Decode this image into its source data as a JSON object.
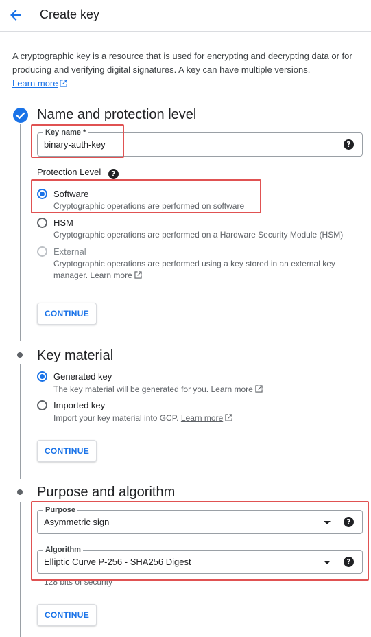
{
  "header": {
    "title": "Create key"
  },
  "intro": {
    "text": "A cryptographic key is a resource that is used for encrypting and decrypting data or for producing and verifying digital signatures. A key can have multiple versions.",
    "link": "Learn more"
  },
  "section1": {
    "title": "Name and protection level",
    "key_name_label": "Key name *",
    "key_name_value": "binary-auth-key",
    "protection_label": "Protection Level",
    "options": [
      {
        "label": "Software",
        "desc": "Cryptographic operations are performed on software",
        "selected": true
      },
      {
        "label": "HSM",
        "desc": "Cryptographic operations are performed on a Hardware Security Module (HSM)",
        "selected": false
      },
      {
        "label": "External",
        "desc": "Cryptographic operations are performed using a key stored in an external key manager.",
        "link": "Learn more",
        "disabled": true
      }
    ],
    "continue": "CONTINUE"
  },
  "section2": {
    "title": "Key material",
    "options": [
      {
        "label": "Generated key",
        "desc": "The key material will be generated for you.",
        "link": "Learn more",
        "selected": true
      },
      {
        "label": "Imported key",
        "desc": "Import your key material into GCP.",
        "link": "Learn more",
        "selected": false
      }
    ],
    "continue": "CONTINUE"
  },
  "section3": {
    "title": "Purpose and algorithm",
    "purpose_label": "Purpose",
    "purpose_value": "Asymmetric sign",
    "algorithm_label": "Algorithm",
    "algorithm_value": "Elliptic Curve P-256 - SHA256 Digest",
    "algorithm_hint": "128 bits of security",
    "continue": "CONTINUE"
  },
  "icons": {
    "back": "arrow-back-icon",
    "help": "help-icon",
    "external": "external-link-icon",
    "check": "check-icon",
    "dropdown": "caret-down-icon"
  },
  "colors": {
    "accent": "#1a73e8",
    "highlight": "#e05252"
  }
}
